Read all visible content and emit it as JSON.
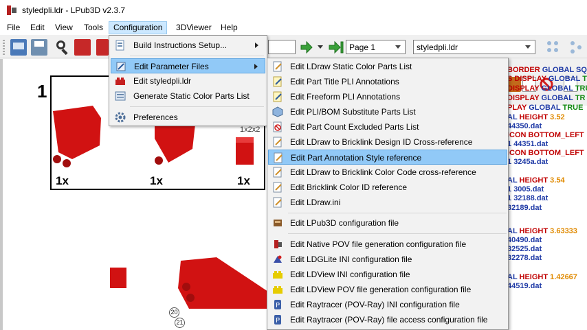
{
  "window": {
    "title": "styledpli.ldr - LPub3D v2.3.7"
  },
  "menubar": {
    "items": [
      "File",
      "Edit",
      "View",
      "Tools",
      "Configuration",
      "3DViewer",
      "Help"
    ]
  },
  "toolbar": {
    "page_input": "",
    "page_select": "Page 1",
    "file_select": "styledpli.ldr"
  },
  "configuration_menu": {
    "items": [
      {
        "label": "Build Instructions Setup...",
        "icon": "build-setup-icon",
        "submenu": true
      },
      {
        "label": "Edit Parameter Files",
        "icon": "edit-parameters-icon",
        "submenu": true,
        "highlighted": true
      },
      {
        "label": "Edit styledpli.ldr",
        "icon": "lego-brick-icon",
        "submenu": false
      },
      {
        "label": "Generate Static Color Parts List",
        "icon": "parts-list-icon",
        "submenu": false
      },
      {
        "label": "Preferences",
        "icon": "gear-icon",
        "submenu": false
      }
    ]
  },
  "parameter_submenu": {
    "items": [
      {
        "label": "Edit LDraw Static Color Parts List",
        "icon": "edit-doc-icon"
      },
      {
        "label": "Edit Part Title PLI Annotations",
        "icon": "edit-note-icon"
      },
      {
        "label": "Edit Freeform PLI Annotations",
        "icon": "edit-note-icon"
      },
      {
        "label": "Edit PLI/BOM Substitute Parts List",
        "icon": "cube-icon"
      },
      {
        "label": "Edit Part Count Excluded Parts List",
        "icon": "excluded-parts-icon"
      },
      {
        "label": "Edit LDraw to Bricklink Design ID Cross-reference",
        "icon": "edit-doc-icon"
      },
      {
        "label": "Edit Part Annotation Style reference",
        "icon": "edit-doc-icon",
        "highlighted": true
      },
      {
        "label": "Edit LDraw to Bricklink Color Code cross-reference",
        "icon": "edit-doc-icon"
      },
      {
        "label": "Edit Bricklink Color ID reference",
        "icon": "edit-doc-icon"
      },
      {
        "label": "Edit LDraw.ini",
        "icon": "edit-doc-icon"
      },
      {
        "label": "Edit LPub3D configuration file",
        "icon": "lpub-config-icon"
      },
      {
        "label": "Edit Native POV file generation configuration file",
        "icon": "pov-native-icon"
      },
      {
        "label": "Edit LDGLite INI configuration file",
        "icon": "ldglite-icon"
      },
      {
        "label": "Edit LDView INI configuration file",
        "icon": "ldview-icon"
      },
      {
        "label": "Edit LDView POV file generation configuration file",
        "icon": "ldview-icon"
      },
      {
        "label": "Edit Raytracer (POV-Ray) INI configuration file",
        "icon": "povray-icon"
      },
      {
        "label": "Edit Raytracer (POV-Ray) file access configuration file",
        "icon": "povray-icon"
      }
    ]
  },
  "canvas": {
    "step_number": "1",
    "pli": {
      "quantities": [
        "1x",
        "1x",
        "1x"
      ],
      "annotation": "1x2x2"
    },
    "callouts": [
      "20",
      "21"
    ]
  },
  "code_panel": {
    "lines": [
      {
        "segments": [
          {
            "text": "BORDER ",
            "color": "red"
          },
          {
            "text": "GLOBAL SQ",
            "color": "blue"
          }
        ]
      },
      {
        "segments": [
          {
            "text": "S DISPLAY ",
            "color": "red"
          },
          {
            "text": "GLOBAL ",
            "color": "blue"
          },
          {
            "text": "TRU",
            "color": "green"
          }
        ]
      },
      {
        "segments": [
          {
            "text": "DISPLAY ",
            "color": "red"
          },
          {
            "text": "GLOBAL ",
            "color": "blue"
          },
          {
            "text": "TRUE",
            "color": "green"
          }
        ]
      },
      {
        "segments": [
          {
            "text": "DISPLAY ",
            "color": "red"
          },
          {
            "text": "GLOBAL ",
            "color": "blue"
          },
          {
            "text": "TR",
            "color": "green"
          }
        ]
      },
      {
        "segments": [
          {
            "text": "PLAY ",
            "color": "red"
          },
          {
            "text": "GLOBAL ",
            "color": "blue"
          },
          {
            "text": "TRUE",
            "color": "green"
          }
        ]
      },
      {
        "segments": [
          {
            "text": "AL ",
            "color": "blue"
          },
          {
            "text": "HEIGHT ",
            "color": "red"
          },
          {
            "text": "3.52",
            "color": "orange"
          }
        ]
      },
      {
        "segments": [
          {
            "text": "44350.dat",
            "color": "blue"
          }
        ]
      },
      {
        "segments": [
          {
            "text": "ICON BOTTOM_LEFT",
            "color": "red"
          }
        ]
      },
      {
        "segments": [
          {
            "text": "1 ",
            "color": "blue"
          },
          {
            "text": "44351.dat",
            "color": "blue"
          }
        ]
      },
      {
        "segments": [
          {
            "text": "ICON BOTTOM_LEFT",
            "color": "red"
          }
        ]
      },
      {
        "segments": [
          {
            "text": "1 ",
            "color": "blue"
          },
          {
            "text": "3245a.dat",
            "color": "blue"
          }
        ]
      },
      {
        "segments": [
          {
            "text": "AL ",
            "color": "blue"
          },
          {
            "text": "HEIGHT ",
            "color": "red"
          },
          {
            "text": "3.54",
            "color": "orange"
          }
        ]
      },
      {
        "segments": [
          {
            "text": "1 ",
            "color": "blue"
          },
          {
            "text": "3005.dat",
            "color": "blue"
          }
        ]
      },
      {
        "segments": [
          {
            "text": "1 ",
            "color": "blue"
          },
          {
            "text": "32188.dat",
            "color": "blue"
          }
        ]
      },
      {
        "segments": [
          {
            "text": "32189.dat",
            "color": "blue"
          }
        ]
      },
      {
        "segments": [
          {
            "text": "AL ",
            "color": "blue"
          },
          {
            "text": "HEIGHT ",
            "color": "red"
          },
          {
            "text": "3.63333",
            "color": "orange"
          }
        ]
      },
      {
        "segments": [
          {
            "text": "40490.dat",
            "color": "blue"
          }
        ]
      },
      {
        "segments": [
          {
            "text": "32525.dat",
            "color": "blue"
          }
        ]
      },
      {
        "segments": [
          {
            "text": "32278.dat",
            "color": "blue"
          }
        ]
      },
      {
        "segments": [
          {
            "text": "AL ",
            "color": "blue"
          },
          {
            "text": "HEIGHT ",
            "color": "red"
          },
          {
            "text": "1.42667",
            "color": "orange"
          }
        ]
      },
      {
        "segments": [
          {
            "text": "44519.dat",
            "color": "blue"
          }
        ]
      }
    ]
  },
  "colors": {
    "accent_highlight": "#91c9f7",
    "lego_red": "#d11212",
    "code_red": "#c00000",
    "code_blue": "#1f3aa6",
    "code_green": "#138a13",
    "code_orange": "#e08a00"
  }
}
